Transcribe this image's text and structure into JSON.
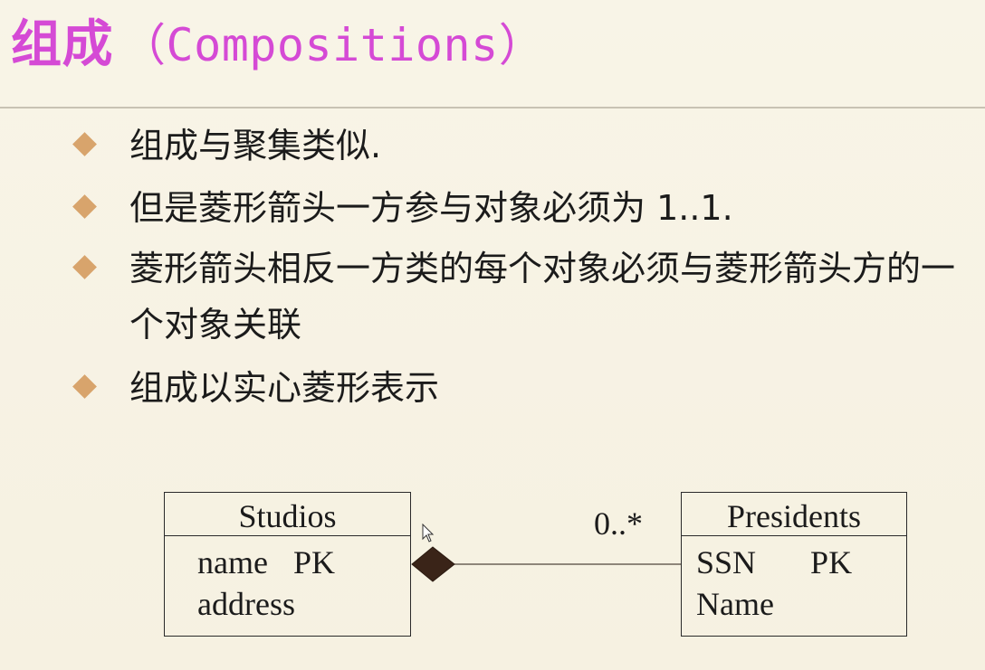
{
  "slide": {
    "title_cn": "组成",
    "title_en": "（Compositions）",
    "bullets": [
      "组成与聚集类似.",
      "但是菱形箭头一方参与对象必须为 1..1.",
      "菱形箭头相反一方类的每个对象必须与菱形箭头方的一个对象关联",
      "组成以实心菱形表示"
    ]
  },
  "diagram": {
    "studios": {
      "name": "Studios",
      "attributes": [
        {
          "name": "name",
          "key": "PK"
        },
        {
          "name": "address",
          "key": ""
        }
      ]
    },
    "presidents": {
      "name": "Presidents",
      "attributes": [
        {
          "name": "SSN",
          "key": "PK"
        },
        {
          "name": "Name",
          "key": ""
        }
      ]
    },
    "multiplicity": "0..*"
  },
  "colors": {
    "title": "#d54ad5",
    "bullet_marker": "#d8a46c",
    "background": "#f6f1e2",
    "composition_diamond": "#3a2418"
  },
  "icons": {
    "bullet": "diamond-bullet-icon",
    "cursor": "mouse-pointer-icon"
  }
}
